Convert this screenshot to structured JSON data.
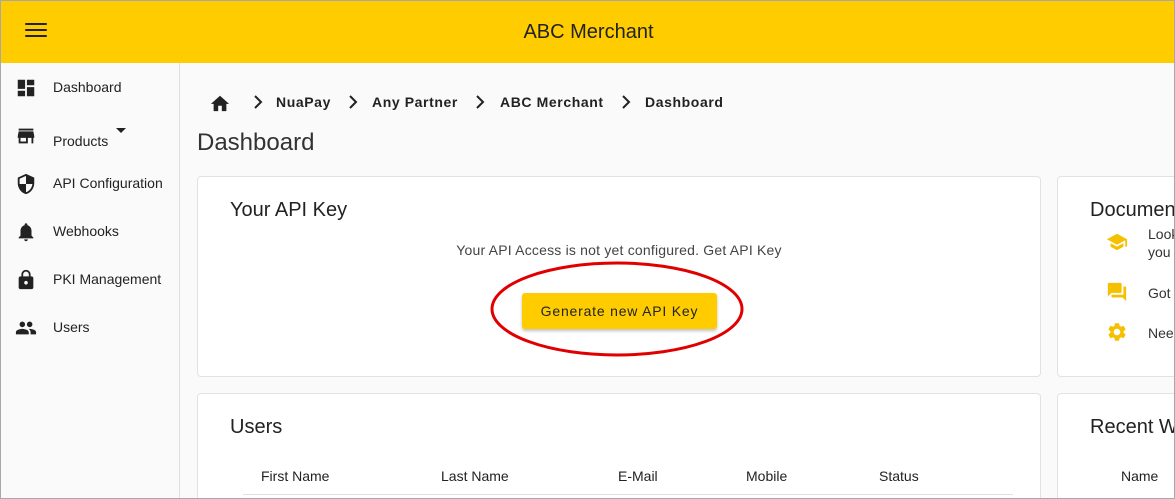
{
  "header": {
    "title": "ABC Merchant",
    "menu_icon": "hamburger-menu-icon",
    "background_color": "#ffcc00"
  },
  "sidebar": {
    "items": [
      {
        "label": "Dashboard",
        "icon": "dashboard-icon"
      },
      {
        "label": "Products",
        "icon": "store-icon",
        "has_dropdown": true
      },
      {
        "label": "API Configuration",
        "icon": "shield-icon"
      },
      {
        "label": "Webhooks",
        "icon": "bell-icon"
      },
      {
        "label": "PKI Management",
        "icon": "lock-icon"
      },
      {
        "label": "Users",
        "icon": "people-icon"
      }
    ]
  },
  "breadcrumb": {
    "home_icon": "home-icon",
    "items": [
      "NuaPay",
      "Any Partner",
      "ABC Merchant",
      "Dashboard"
    ]
  },
  "page": {
    "title": "Dashboard"
  },
  "api_key_card": {
    "title": "Your API Key",
    "message": "Your API Access is not yet configured. Get API Key",
    "button_label": "Generate new API Key",
    "highlight_color": "#e00000"
  },
  "documentation_card": {
    "title": "Documen",
    "rows": [
      {
        "icon": "school-cap-icon",
        "line1": "Look",
        "line2": "you"
      },
      {
        "icon": "chat-bubbles-icon",
        "line1": "Got"
      },
      {
        "icon": "gear-icon",
        "line1": "Nee"
      }
    ]
  },
  "users_card": {
    "title": "Users",
    "columns": [
      "First Name",
      "Last Name",
      "E-Mail",
      "Mobile",
      "Status"
    ]
  },
  "recent_card": {
    "title": "Recent W",
    "columns": [
      "Name"
    ]
  }
}
